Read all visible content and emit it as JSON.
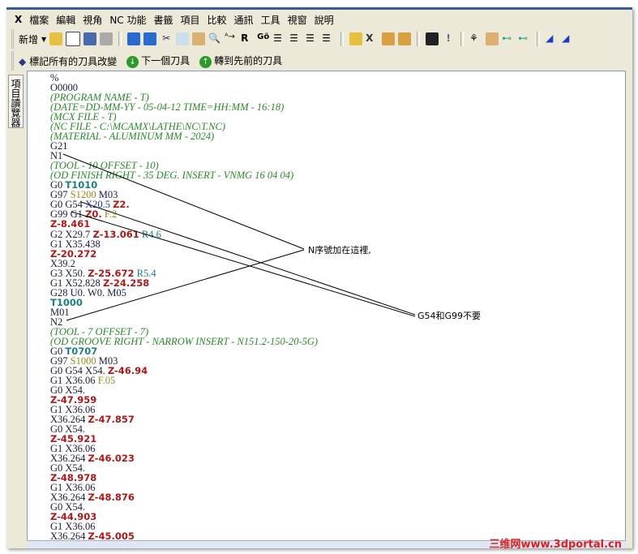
{
  "menu": [
    "檔案",
    "編輯",
    "視角",
    "NC 功能",
    "書籤",
    "項目",
    "比較",
    "通訊",
    "工具",
    "視窗",
    "說明"
  ],
  "toolbar": {
    "new_label": "新增"
  },
  "toolbar2": {
    "mark_all": "標記所有的刀具改變",
    "next_tool": "下一個刀具",
    "prev_tool": "轉到先前的刀具"
  },
  "side_tab": "項目讀覽器",
  "code_lines": [
    [
      [
        "n",
        "%"
      ]
    ],
    [
      [
        "n",
        "O0000"
      ]
    ],
    [
      [
        "cm",
        "(PROGRAM NAME - T)"
      ]
    ],
    [
      [
        "cm",
        "(DATE=DD-MM-YY - 05-04-12 TIME=HH:MM - 16:18)"
      ]
    ],
    [
      [
        "cm",
        "(MCX FILE - T)"
      ]
    ],
    [
      [
        "cm",
        "(NC FILE - C:\\MCAMX\\LATHE\\NC\\T.NC)"
      ]
    ],
    [
      [
        "cm",
        "(MATERIAL - ALUMINUM MM - 2024)"
      ]
    ],
    [
      [
        "n",
        "G21"
      ]
    ],
    [
      [
        "n",
        "N1"
      ]
    ],
    [
      [
        "cm",
        "(TOOL - 10 OFFSET - 10)"
      ]
    ],
    [
      [
        "cm",
        "(OD FINISH RIGHT - 35 DEG. INSERT - VNMG 16 04 04)"
      ]
    ],
    [
      [
        "n",
        "G0 "
      ],
      [
        "t",
        "T1010"
      ]
    ],
    [
      [
        "n",
        "G97 "
      ],
      [
        "s",
        "S1200"
      ],
      [
        "n",
        " M03"
      ]
    ],
    [
      [
        "n",
        "G0 G54 "
      ],
      [
        "x",
        "X20.5"
      ],
      [
        "n",
        " "
      ],
      [
        "z",
        "Z2."
      ]
    ],
    [
      [
        "n",
        "G99 G1 "
      ],
      [
        "z",
        "Z0."
      ],
      [
        "n",
        " "
      ],
      [
        "s",
        "F.2"
      ]
    ],
    [
      [
        "z",
        "Z-8.461"
      ]
    ],
    [
      [
        "n",
        "G2 X29.7 "
      ],
      [
        "z",
        "Z-13.061"
      ],
      [
        "n",
        " "
      ],
      [
        "r",
        "R4.6"
      ]
    ],
    [
      [
        "n",
        "G1 X35.438"
      ]
    ],
    [
      [
        "z",
        "Z-20.272"
      ]
    ],
    [
      [
        "n",
        "X39.2"
      ]
    ],
    [
      [
        "n",
        "G3 X50. "
      ],
      [
        "z",
        "Z-25.672"
      ],
      [
        "n",
        " "
      ],
      [
        "r",
        "R5.4"
      ]
    ],
    [
      [
        "n",
        "G1 X52.828 "
      ],
      [
        "z",
        "Z-24.258"
      ]
    ],
    [
      [
        "n",
        "G28 U0. W0. M05"
      ]
    ],
    [
      [
        "t",
        "T1000"
      ]
    ],
    [
      [
        "n",
        "M01"
      ]
    ],
    [
      [
        "n",
        "N2"
      ]
    ],
    [
      [
        "cm",
        "(TOOL - 7 OFFSET - 7)"
      ]
    ],
    [
      [
        "cm",
        "(OD GROOVE RIGHT - NARROW INSERT - N151.2-150-20-5G)"
      ]
    ],
    [
      [
        "n",
        "G0 "
      ],
      [
        "t",
        "T0707"
      ]
    ],
    [
      [
        "n",
        "G97 "
      ],
      [
        "s",
        "S1000"
      ],
      [
        "n",
        " M03"
      ]
    ],
    [
      [
        "n",
        "G0 G54 X54. "
      ],
      [
        "z",
        "Z-46.94"
      ]
    ],
    [
      [
        "n",
        "G1 X36.06 "
      ],
      [
        "s",
        "F.05"
      ]
    ],
    [
      [
        "n",
        "G0 X54."
      ]
    ],
    [
      [
        "z",
        "Z-47.959"
      ]
    ],
    [
      [
        "n",
        "G1 X36.06"
      ]
    ],
    [
      [
        "n",
        "X36.264 "
      ],
      [
        "z",
        "Z-47.857"
      ]
    ],
    [
      [
        "n",
        "G0 X54."
      ]
    ],
    [
      [
        "z",
        "Z-45.921"
      ]
    ],
    [
      [
        "n",
        "G1 X36.06"
      ]
    ],
    [
      [
        "n",
        "X36.264 "
      ],
      [
        "z",
        "Z-46.023"
      ]
    ],
    [
      [
        "n",
        "G0 X54."
      ]
    ],
    [
      [
        "z",
        "Z-48.978"
      ]
    ],
    [
      [
        "n",
        "G1 X36.06"
      ]
    ],
    [
      [
        "n",
        "X36.264 "
      ],
      [
        "z",
        "Z-48.876"
      ]
    ],
    [
      [
        "n",
        "G0 X54."
      ]
    ],
    [
      [
        "z",
        "Z-44.903"
      ]
    ],
    [
      [
        "n",
        "G1 X36.06"
      ]
    ],
    [
      [
        "n",
        "X36.264 "
      ],
      [
        "z",
        "Z-45.005"
      ]
    ]
  ],
  "annotations": {
    "n_seq": "N序號加在這裡,",
    "g54_g99": "G54和G99不要"
  },
  "watermark": "三维网www.3dportal.cn"
}
